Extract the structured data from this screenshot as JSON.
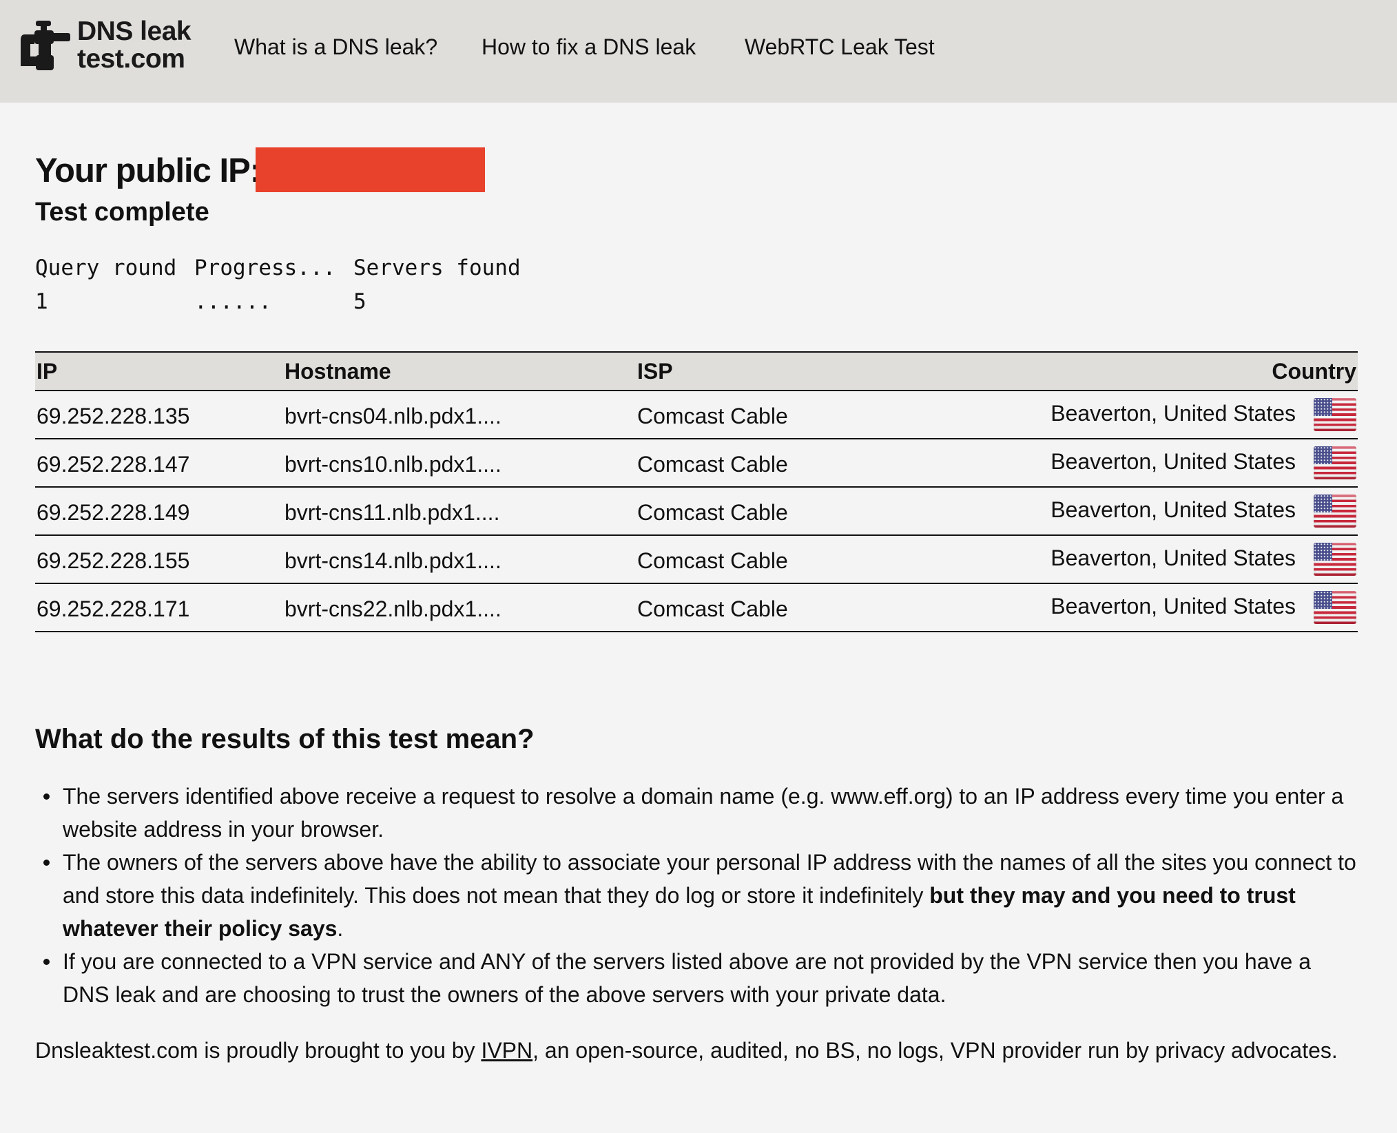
{
  "header": {
    "logo_line1": "DNS leak",
    "logo_line2": "test.com",
    "nav": [
      {
        "label": "What is a DNS leak?"
      },
      {
        "label": "How to fix a DNS leak"
      },
      {
        "label": "WebRTC Leak Test"
      }
    ],
    "background": "#dfdedb"
  },
  "main": {
    "ip_label": "Your public IP:",
    "ip_redaction_color": "#e8412c",
    "status": "Test complete",
    "progress": {
      "headers": [
        "Query round",
        "Progress...",
        "Servers found"
      ],
      "values": [
        "1",
        "......",
        "5"
      ]
    }
  },
  "table": {
    "headers": [
      "IP",
      "Hostname",
      "ISP",
      "Country"
    ],
    "rows": [
      {
        "ip": "69.252.228.135",
        "hostname": "bvrt-cns04.nlb.pdx1....",
        "isp": "Comcast Cable",
        "country": "Beaverton, United States",
        "flag": "us-flag-icon"
      },
      {
        "ip": "69.252.228.147",
        "hostname": "bvrt-cns10.nlb.pdx1....",
        "isp": "Comcast Cable",
        "country": "Beaverton, United States",
        "flag": "us-flag-icon"
      },
      {
        "ip": "69.252.228.149",
        "hostname": "bvrt-cns11.nlb.pdx1....",
        "isp": "Comcast Cable",
        "country": "Beaverton, United States",
        "flag": "us-flag-icon"
      },
      {
        "ip": "69.252.228.155",
        "hostname": "bvrt-cns14.nlb.pdx1....",
        "isp": "Comcast Cable",
        "country": "Beaverton, United States",
        "flag": "us-flag-icon"
      },
      {
        "ip": "69.252.228.171",
        "hostname": "bvrt-cns22.nlb.pdx1....",
        "isp": "Comcast Cable",
        "country": "Beaverton, United States",
        "flag": "us-flag-icon"
      }
    ]
  },
  "explanation": {
    "title": "What do the results of this test mean?",
    "bullet1": "The servers identified above receive a request to resolve a domain name (e.g. www.eff.org) to an IP address every time you enter a website address in your browser.",
    "bullet2_plain": "The owners of the servers above have the ability to associate your personal IP address with the names of all the sites you connect to and store this data indefinitely. This does not mean that they do log or store it indefinitely ",
    "bullet2_bold": "but they may and you need to trust whatever their policy says",
    "bullet2_end": ".",
    "bullet3": "If you are connected to a VPN service and ANY of the servers listed above are not provided by the VPN service then you have a DNS leak and are choosing to trust the owners of the above servers with your private data."
  },
  "footer": {
    "before_link": "Dnsleaktest.com is proudly brought to you by ",
    "link": "IVPN",
    "after_link": ", an open-source, audited, no BS, no logs, VPN provider run by privacy advocates."
  }
}
